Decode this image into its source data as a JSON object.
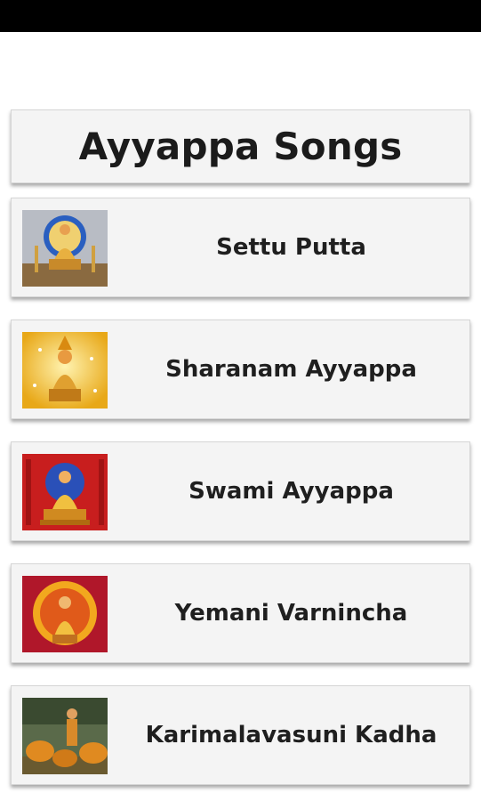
{
  "header": {
    "title": "Ayyappa Songs"
  },
  "songs": [
    {
      "label": "Settu Putta",
      "icon": "deity-portrait-icon",
      "bg": "#9aa3b0",
      "accent": "#e0b040"
    },
    {
      "label": "Sharanam Ayyappa",
      "icon": "deity-portrait-icon",
      "bg": "#f2c230",
      "accent": "#d98a10"
    },
    {
      "label": "Swami Ayyappa",
      "icon": "deity-portrait-icon",
      "bg": "#c81e1e",
      "accent": "#f0c040"
    },
    {
      "label": "Yemani Varnincha",
      "icon": "deity-portrait-icon",
      "bg": "#b0172a",
      "accent": "#f2a81e"
    },
    {
      "label": "Karimalavasuni Kadha",
      "icon": "deity-with-tigers-icon",
      "bg": "#4a5a3a",
      "accent": "#d9902a"
    }
  ]
}
